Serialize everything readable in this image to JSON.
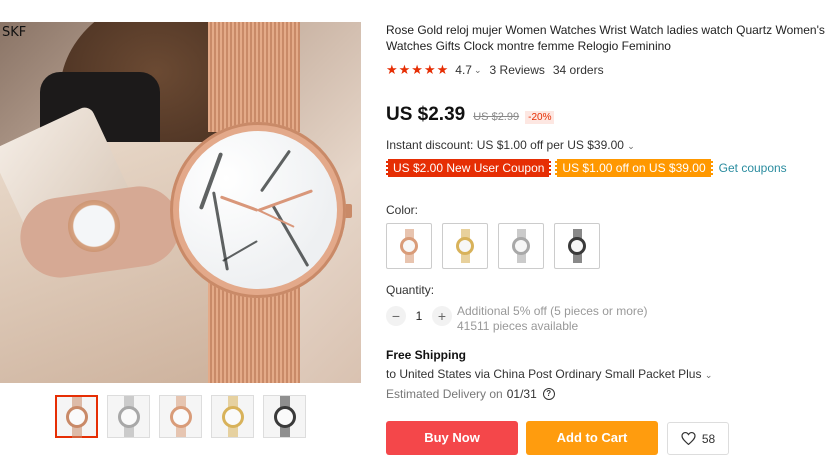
{
  "brand_watermark": "SKF",
  "product": {
    "title": "Rose Gold reloj mujer Women Watches Wrist Watch ladies watch Quartz Women's Watches Gifts Clock montre femme Relogio Feminino",
    "rating_value": "4.7",
    "reviews": "3 Reviews",
    "orders": "34 orders"
  },
  "price": {
    "current": "US $2.39",
    "original": "US $2.99",
    "discount": "-20%"
  },
  "instant_discount": "Instant discount: US $1.00 off per US $39.00",
  "coupons": {
    "new_user": "US $2.00 New User Coupon",
    "store": "US $1.00 off on US $39.00",
    "get_link": "Get coupons"
  },
  "color": {
    "label": "Color:",
    "options": [
      {
        "name": "rose-gold",
        "color": "#d99c79"
      },
      {
        "name": "gold",
        "color": "#d8b25a"
      },
      {
        "name": "silver",
        "color": "#a8a8a8"
      },
      {
        "name": "black",
        "color": "#3a3a3a"
      }
    ]
  },
  "quantity": {
    "label": "Quantity:",
    "minus": "−",
    "value": "1",
    "plus": "+",
    "promo": "Additional 5% off (5 pieces or more)",
    "available": "41511 pieces available"
  },
  "shipping": {
    "title": "Free Shipping",
    "line": "to United States via China Post Ordinary Small Packet Plus",
    "delivery_label": "Estimated Delivery on",
    "delivery_date": "01/31"
  },
  "actions": {
    "buy": "Buy Now",
    "cart": "Add to Cart",
    "wishlist_count": "58"
  },
  "thumbnails": [
    {
      "name": "model-photo",
      "color": "#c98a68"
    },
    {
      "name": "silver",
      "color": "#a8a8a8"
    },
    {
      "name": "rose-gold",
      "color": "#d99c79"
    },
    {
      "name": "gold",
      "color": "#d8b25a"
    },
    {
      "name": "black",
      "color": "#3a3a3a"
    }
  ],
  "colors": {
    "accent_red": "#e62e04",
    "buy_button": "#f4474a",
    "cart_button": "#ff9c0e",
    "coupon_orange": "#ff9800",
    "link_teal": "#2a8c9f",
    "stars": "#e62e04"
  }
}
